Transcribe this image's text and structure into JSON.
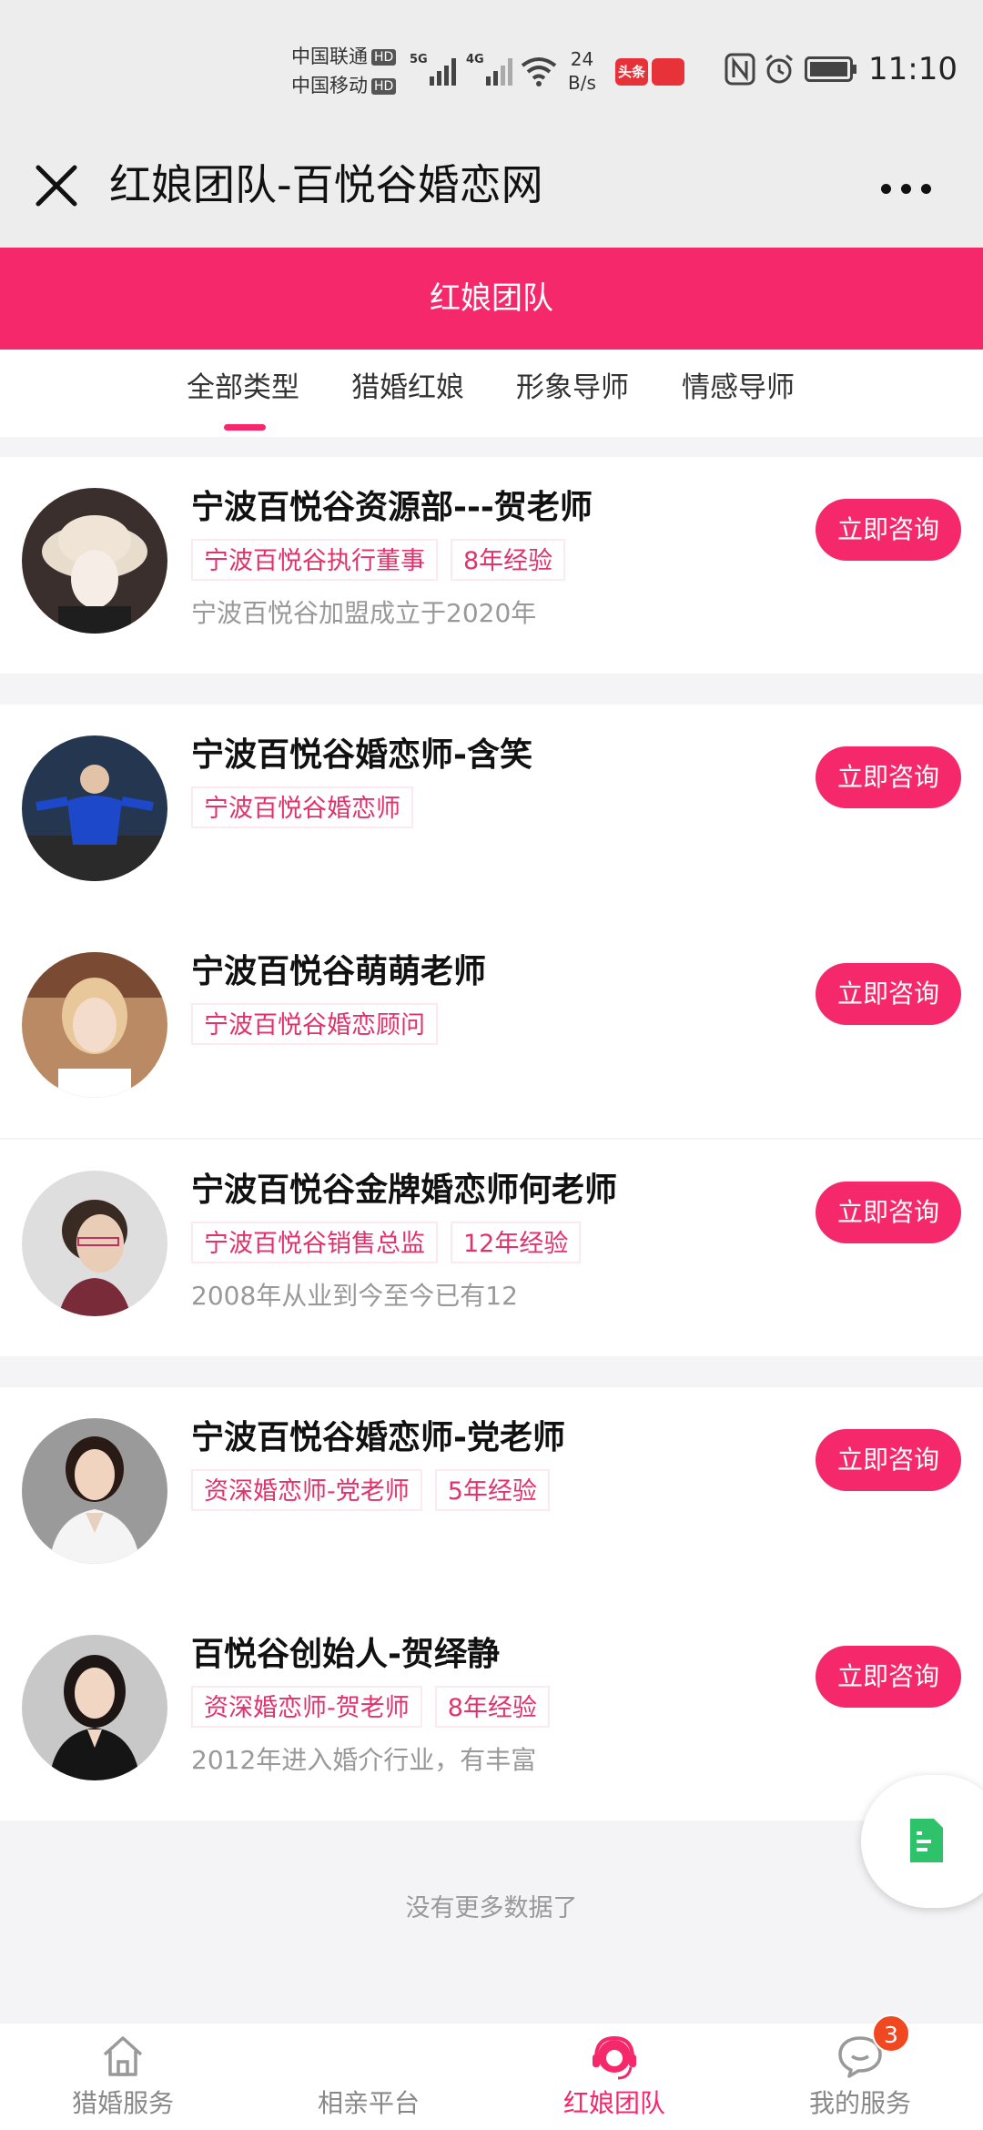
{
  "status_bar": {
    "carrier1": "中国联通",
    "carrier2": "中国移动",
    "hd": "HD",
    "net1": "5G",
    "net2": "4G",
    "speed_value": "24",
    "speed_unit": "B/s",
    "app_badge1": "头条",
    "time": "11:10"
  },
  "nav": {
    "title": "红娘团队-百悦谷婚恋网"
  },
  "header": {
    "title": "红娘团队"
  },
  "tabs": [
    {
      "label": "全部类型",
      "active": true
    },
    {
      "label": "猎婚红娘",
      "active": false
    },
    {
      "label": "形象导师",
      "active": false
    },
    {
      "label": "情感导师",
      "active": false
    }
  ],
  "consultants": [
    {
      "name": "宁波百悦谷资源部---贺老师",
      "tags": [
        "宁波百悦谷执行董事",
        "8年经验"
      ],
      "desc": "宁波百悦谷加盟成立于2020年",
      "button": "立即咨询"
    },
    {
      "name": "宁波百悦谷婚恋师-含笑",
      "tags": [
        "宁波百悦谷婚恋师"
      ],
      "desc": "",
      "button": "立即咨询"
    },
    {
      "name": "宁波百悦谷萌萌老师",
      "tags": [
        "宁波百悦谷婚恋顾问"
      ],
      "desc": "",
      "button": "立即咨询"
    },
    {
      "name": "宁波百悦谷金牌婚恋师何老师",
      "tags": [
        "宁波百悦谷销售总监",
        "12年经验"
      ],
      "desc": "2008年从业到今至今已有12",
      "button": "立即咨询"
    },
    {
      "name": "宁波百悦谷婚恋师-党老师",
      "tags": [
        "资深婚恋师-党老师",
        "5年经验"
      ],
      "desc": "",
      "button": "立即咨询"
    },
    {
      "name": "百悦谷创始人-贺绎静",
      "tags": [
        "资深婚恋师-贺老师",
        "8年经验"
      ],
      "desc": "2012年进入婚介行业，有丰富",
      "button": "立即咨询"
    }
  ],
  "list_footer": "没有更多数据了",
  "bottom_nav": [
    {
      "label": "猎婚服务",
      "icon": "home-icon",
      "active": false
    },
    {
      "label": "相亲平台",
      "icon": "heart-icon",
      "active": false
    },
    {
      "label": "红娘团队",
      "icon": "headset-icon",
      "active": true
    },
    {
      "label": "我的服务",
      "icon": "chat-icon",
      "active": false,
      "badge": "3"
    }
  ],
  "colors": {
    "accent": "#f5286b",
    "tag_text": "#e0336c",
    "badge": "#f04820",
    "float_icon": "#2ec26a"
  }
}
